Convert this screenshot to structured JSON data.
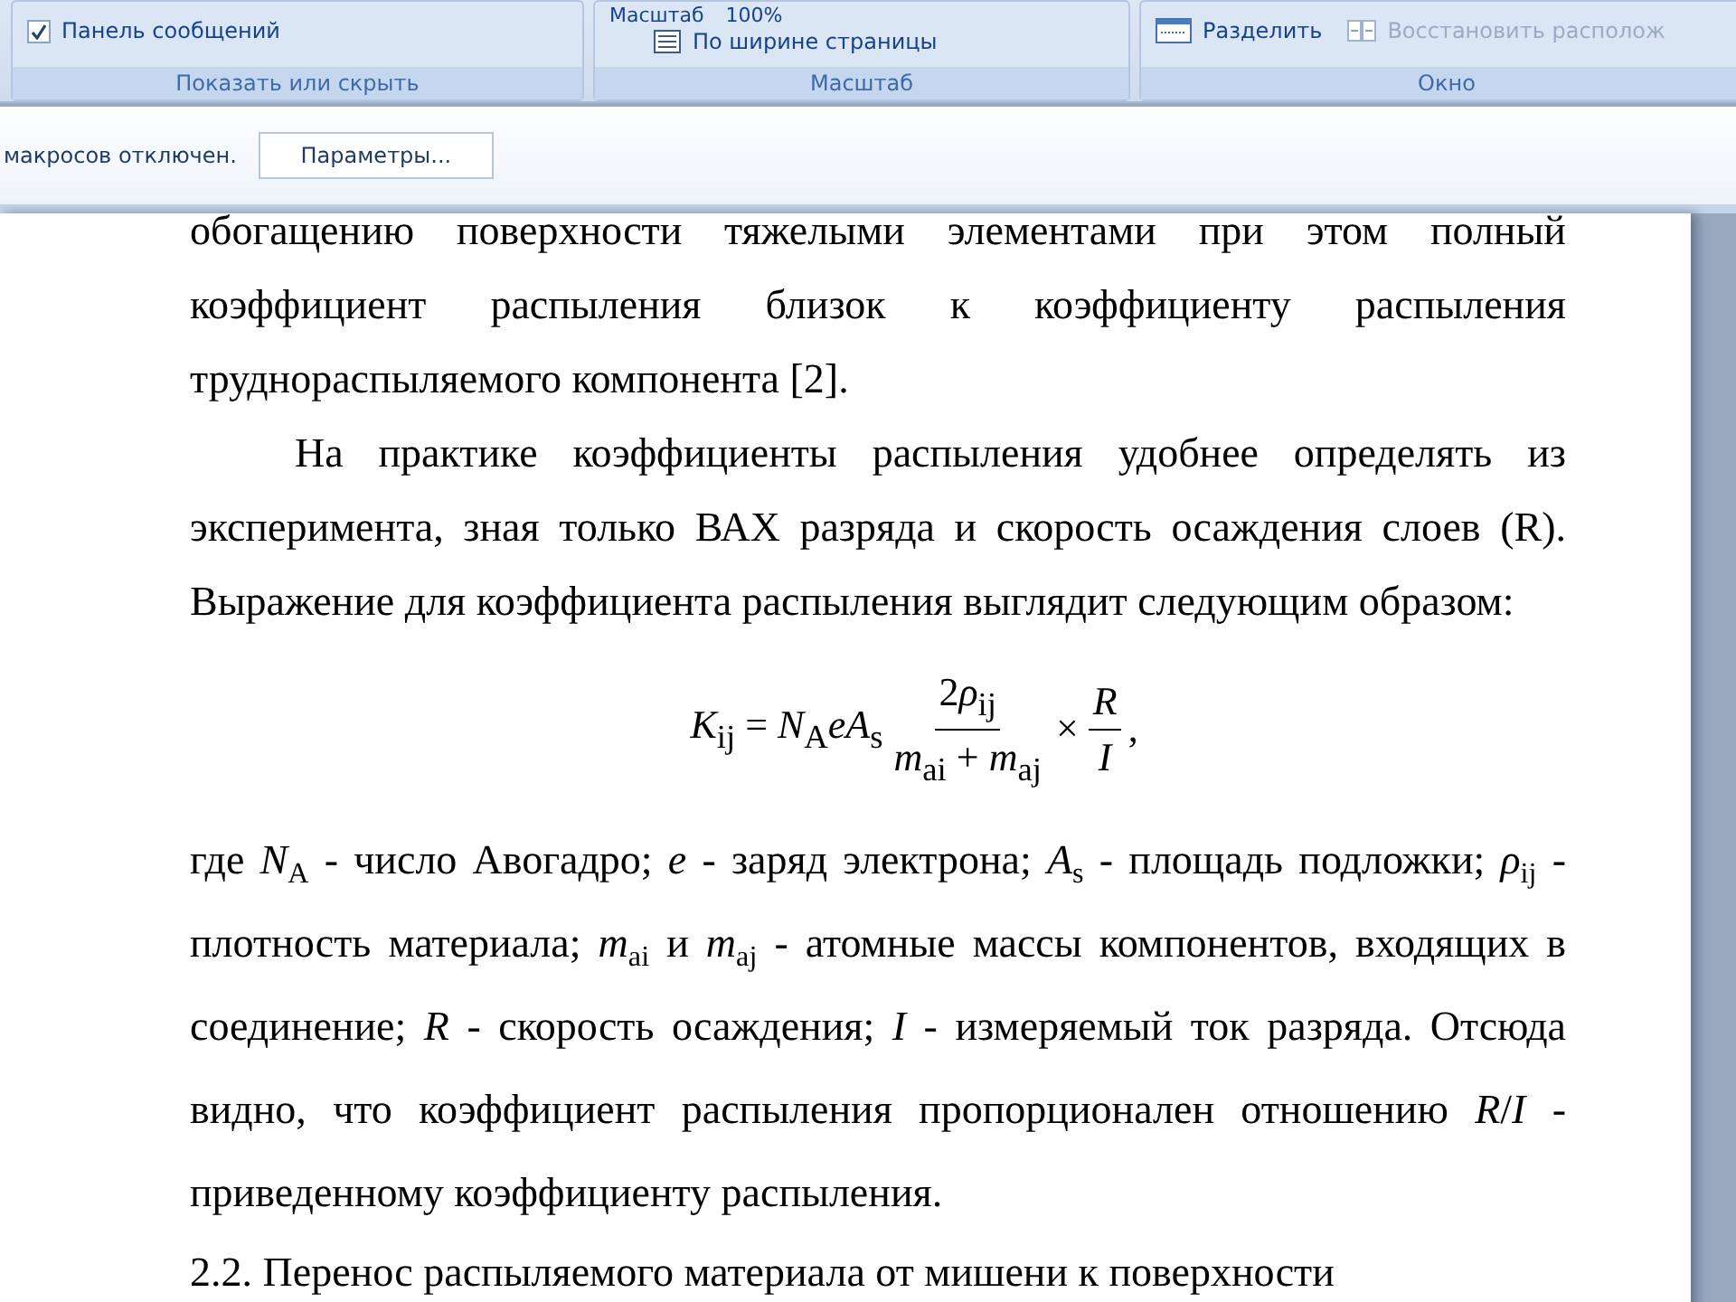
{
  "ribbon": {
    "groups": [
      {
        "label": "Показать или скрыть",
        "items": [
          {
            "kind": "checkbox",
            "label": "Панель сообщений",
            "checked": true
          }
        ]
      },
      {
        "label": "Масштаб",
        "items": [
          {
            "kind": "zoom",
            "label": "Масштаб",
            "value": "100%"
          },
          {
            "kind": "button",
            "label": "По ширине страницы"
          }
        ]
      },
      {
        "label": "Окно",
        "items": [
          {
            "kind": "button",
            "label": "Разделить",
            "disabled": false
          },
          {
            "kind": "button",
            "label": "Восстановить располож",
            "disabled": true
          }
        ]
      }
    ]
  },
  "message_bar": {
    "text": "макросов отключен.",
    "button": "Параметры..."
  },
  "document": {
    "blocks": [
      {
        "kind": "paragraph",
        "indent": false,
        "text": "обогащению поверхности тяжелыми элементами при этом полный коэффициент распыления близок к коэффициенту распыления труднораспыляемого компонента [2]."
      },
      {
        "kind": "paragraph",
        "indent": true,
        "text": "На практике коэффициенты распыления удобнее определять из эксперимента, зная только ВАХ разряда и скорость осаждения слоев (R). Выражение для коэффициента распыления выглядит следующим образом:"
      },
      {
        "kind": "formula",
        "lhs": "*K*$_{ij}$ = *N*$_{A}$*eA*$_{s}$",
        "coefficient": "2",
        "numerator": "*ρ*$_{ij}$",
        "denominator": "*m*$_{ai}$ + *m*$_{aj}$",
        "times": "×",
        "numerator2": "*R*",
        "denominator2": "*I*",
        "end": ","
      },
      {
        "kind": "paragraph",
        "indent": false,
        "spaced": true,
        "text": "где *N*$_{A}$ - число  Авогадро; *e* - заряд электрона; *A*$_{s}$ - площадь подложки; *ρ*$_{ij}$ - плотность материала; *m*$_{ai}$ и *m*$_{aj}$ - атомные массы компонентов, входящих в соединение; *R* - скорость осаждения; *I* - измеряемый ток разряда. Отсюда видно, что коэффициент распыления пропорционален отношению *R*/*I* - приведенному коэффициенту распыления."
      },
      {
        "kind": "paragraph",
        "indent": false,
        "text": "2.2. Перенос распыляемого материала от мишени к поверхности"
      }
    ]
  }
}
